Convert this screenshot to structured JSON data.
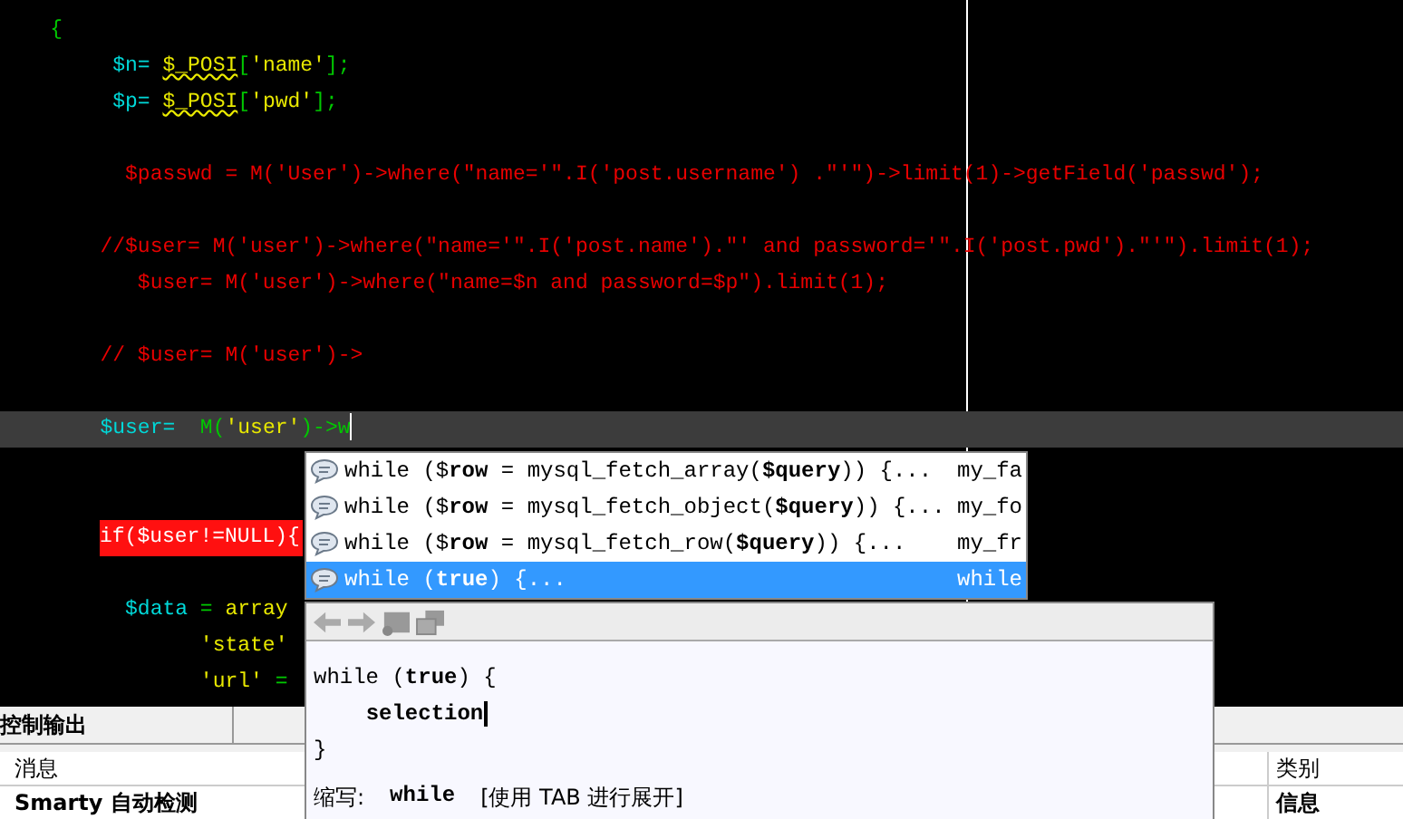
{
  "editor": {
    "lines": [
      {
        "kind": "code",
        "tokens": [
          {
            "kind": "punc",
            "text": "    {"
          }
        ]
      },
      {
        "kind": "code",
        "tokens": [
          {
            "kind": "var",
            "text": "         $n= "
          },
          {
            "kind": "super",
            "text": "$_POSI"
          },
          {
            "kind": "punc",
            "text": "["
          },
          {
            "kind": "str",
            "text": "'name'"
          },
          {
            "kind": "punc",
            "text": "];"
          }
        ]
      },
      {
        "kind": "code",
        "tokens": [
          {
            "kind": "var",
            "text": "         $p= "
          },
          {
            "kind": "super",
            "text": "$_POSI"
          },
          {
            "kind": "punc",
            "text": "["
          },
          {
            "kind": "str",
            "text": "'pwd'"
          },
          {
            "kind": "punc",
            "text": "];"
          }
        ]
      },
      {
        "kind": "code"
      },
      {
        "kind": "code",
        "tokens": [
          {
            "kind": "red",
            "text": "          $passwd = M('User')->where(\"name='\".I('post.username') .\"'\")->limit(1)->getField('passwd');"
          }
        ]
      },
      {
        "kind": "code"
      },
      {
        "kind": "code",
        "tokens": [
          {
            "kind": "red",
            "text": "        //$user= M('user')->where(\"name='\".I('post.name').\"' and password='\".I('post.pwd').\"'\").limit(1);"
          }
        ]
      },
      {
        "kind": "code",
        "tokens": [
          {
            "kind": "red",
            "text": "           $user= M('user')->where(\"name=$n and password=$p\").limit(1);"
          }
        ]
      },
      {
        "kind": "code"
      },
      {
        "kind": "code",
        "tokens": [
          {
            "kind": "red",
            "text": "        // $user= M('user')->"
          }
        ]
      },
      {
        "kind": "code"
      },
      {
        "kind": "current",
        "tokens": [
          {
            "kind": "var",
            "text": "        $user=  "
          },
          {
            "kind": "punc",
            "text": "M("
          },
          {
            "kind": "str",
            "text": "'user'"
          },
          {
            "kind": "punc",
            "text": ")->w"
          }
        ]
      },
      {
        "kind": "code"
      },
      {
        "kind": "code"
      },
      {
        "kind": "error",
        "tokens": [
          {
            "kind": "mark",
            "text": "if($user!=NULL){"
          }
        ]
      },
      {
        "kind": "code"
      },
      {
        "kind": "code",
        "tokens": [
          {
            "kind": "var",
            "text": "          $data"
          },
          {
            "kind": "punc",
            "text": " = "
          },
          {
            "kind": "str",
            "text": "array"
          }
        ]
      },
      {
        "kind": "code",
        "tokens": [
          {
            "kind": "str",
            "text": "                'state'"
          }
        ]
      },
      {
        "kind": "code",
        "tokens": [
          {
            "kind": "str",
            "text": "                'url'"
          },
          {
            "kind": "punc",
            "text": " ="
          }
        ]
      }
    ]
  },
  "completion": {
    "items": [
      {
        "text": "while ($**row** = mysql_fetch_array(**$query**)) {...",
        "shortcut": "my_fa",
        "selected": false
      },
      {
        "text": "while ($**row** = mysql_fetch_object(**$query**)) {...",
        "shortcut": "my_fo",
        "selected": false
      },
      {
        "text": "while ($**row** = mysql_fetch_row(**$query**)) {...",
        "shortcut": "my_fr",
        "selected": false
      },
      {
        "text": "while (**true**) {...",
        "shortcut": "while",
        "selected": true
      }
    ]
  },
  "preview": {
    "code": [
      "while (**true**) {",
      "    **selection**",
      "}"
    ],
    "abbrev_label": "缩写:",
    "abbrev": "while",
    "hint": "[使用 TAB 进行展开]"
  },
  "output": {
    "tab": "控制输出",
    "columns": [
      "消息",
      "类别"
    ],
    "rows": [
      [
        "Smarty 自动检测",
        "信息"
      ]
    ]
  }
}
